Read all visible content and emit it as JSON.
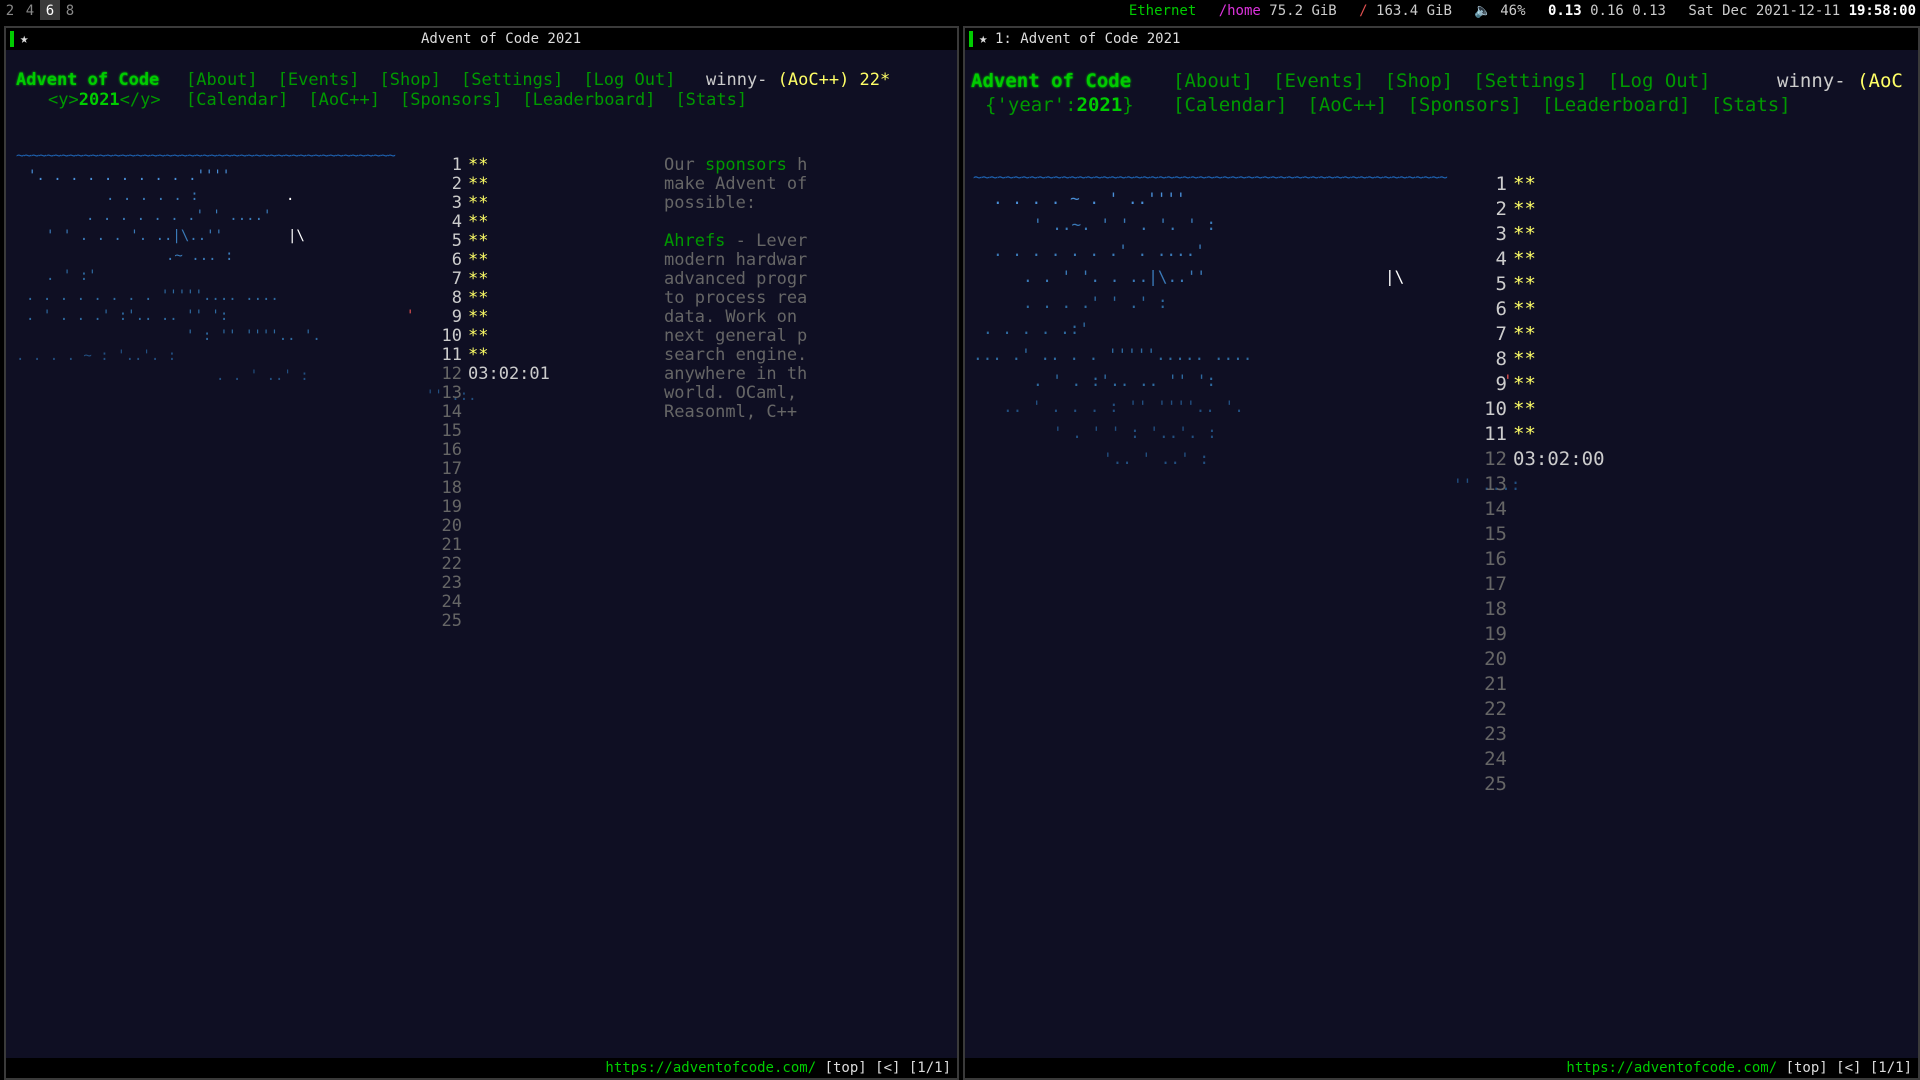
{
  "bar": {
    "workspaces": [
      "2",
      "4",
      "6",
      "8"
    ],
    "active_workspace": "6",
    "network": "Ethernet",
    "home_label": "/home",
    "home_free": "75.2 GiB",
    "root_label": "/",
    "root_free": "163.4 GiB",
    "volume": "46%",
    "load1": "0.13",
    "load_rest": "0.16 0.13",
    "date": "Sat Dec 2021-12-11",
    "time": "19:58:00"
  },
  "left": {
    "title": "Advent of Code 2021",
    "site_title": "Advent of Code",
    "year_prefix": "<y>",
    "year": "2021",
    "year_suffix": "</y>",
    "nav1": [
      "[About]",
      "[Events]",
      "[Shop]",
      "[Settings]",
      "[Log Out]"
    ],
    "nav2": [
      "[Calendar]",
      "[AoC++]",
      "[Sponsors]",
      "[Leaderboard]",
      "[Stats]"
    ],
    "user": "winny-",
    "aocpp": "(AoC++) 22*",
    "ocean": "~~~~~~~~~~~~~~~~~~~~~~~~~~~~~~~~~~~~~~~~~~~~~~~~~~~",
    "timer": "03:02:01",
    "sponsor_lines": [
      [
        "Our ",
        "sponsors",
        " h"
      ],
      [
        "make Advent of"
      ],
      [
        "possible:"
      ],
      [
        ""
      ],
      [
        "Ahrefs",
        " - Lever"
      ],
      [
        "modern hardwar"
      ],
      [
        "advanced progr"
      ],
      [
        "to process rea"
      ],
      [
        "data. Work on"
      ],
      [
        "next general p"
      ],
      [
        "search engine."
      ],
      [
        "anywhere in th"
      ],
      [
        "world. OCaml,"
      ],
      [
        "Reasonml, C++"
      ]
    ],
    "url": "https://adventofcode.com/",
    "mode": "[top] [<] [1/1]"
  },
  "right": {
    "title": "1: Advent of Code 2021",
    "site_title": "Advent of Code",
    "year_prefix": "{'year':",
    "year": "2021",
    "year_suffix": "}",
    "nav1": [
      "[About]",
      "[Events]",
      "[Shop]",
      "[Settings]",
      "[Log Out]"
    ],
    "nav2": [
      "[Calendar]",
      "[AoC++]",
      "[Sponsors]",
      "[Leaderboard]",
      "[Stats]"
    ],
    "user": "winny-",
    "aocpp": "(AoC",
    "ocean": "~~~~~~~~~~~~~~~~~~~~~~~~~~~~~~~~~~~~~~~~~~~~~~~~~~~~~~~~~~~",
    "timer": "03:02:00",
    "url": "https://adventofcode.com/",
    "mode": "[top] [<] [1/1]"
  },
  "days": [
    "1",
    "2",
    "3",
    "4",
    "5",
    "6",
    "7",
    "8",
    "9",
    "10",
    "11",
    "12",
    "13",
    "14",
    "15",
    "16",
    "17",
    "18",
    "19",
    "20",
    "21",
    "22",
    "23",
    "24",
    "25"
  ],
  "stars_text": "**",
  "completed_days": 11,
  "colors": {
    "green": "#00cc00",
    "dark_green": "#009900",
    "star_yellow": "#ffff66",
    "bg": "#0f0f23"
  }
}
